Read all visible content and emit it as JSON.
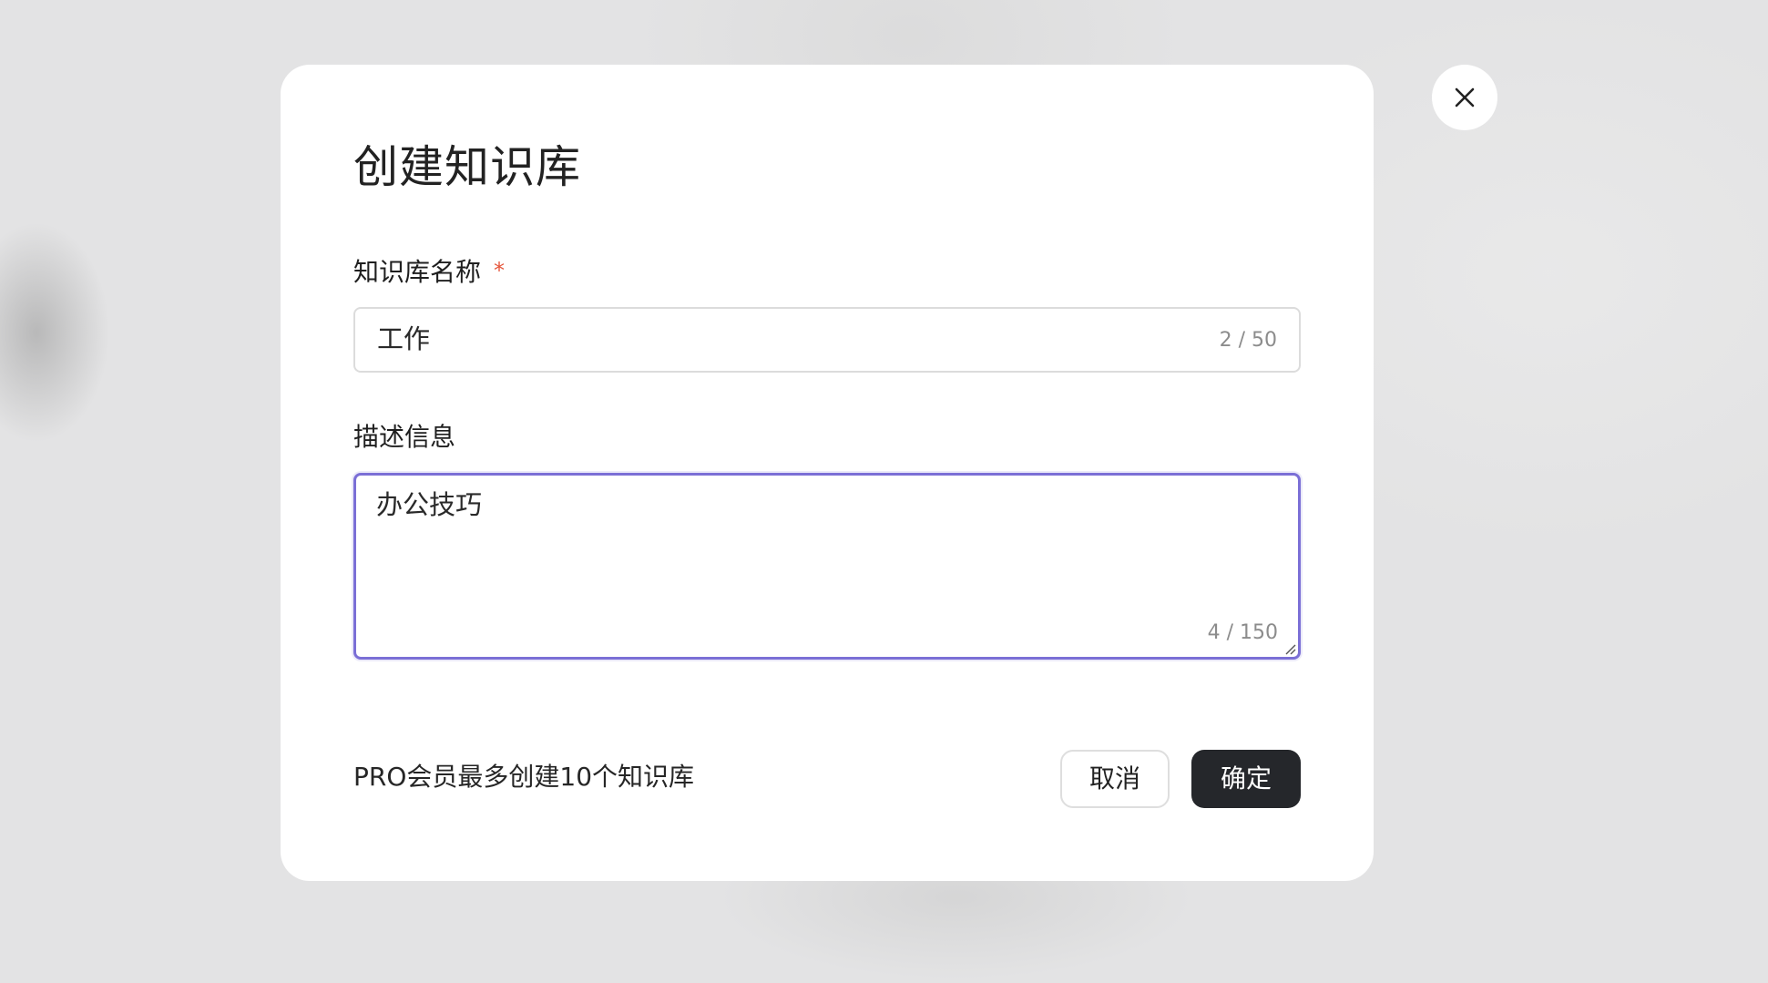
{
  "dialog": {
    "title": "创建知识库",
    "name_field": {
      "label": "知识库名称",
      "required_mark": "*",
      "value": "工作",
      "counter": "2 / 50"
    },
    "description_field": {
      "label": "描述信息",
      "value": "办公技巧",
      "counter": "4 / 150"
    },
    "footer_note": "PRO会员最多创建10个知识库",
    "cancel_label": "取消",
    "confirm_label": "确定"
  },
  "colors": {
    "focus_border": "#7b6fd6",
    "confirm_bg": "#25272b",
    "required": "#e5553b"
  },
  "icons": {
    "close": "close-icon",
    "resize": "resize-grip-icon"
  }
}
